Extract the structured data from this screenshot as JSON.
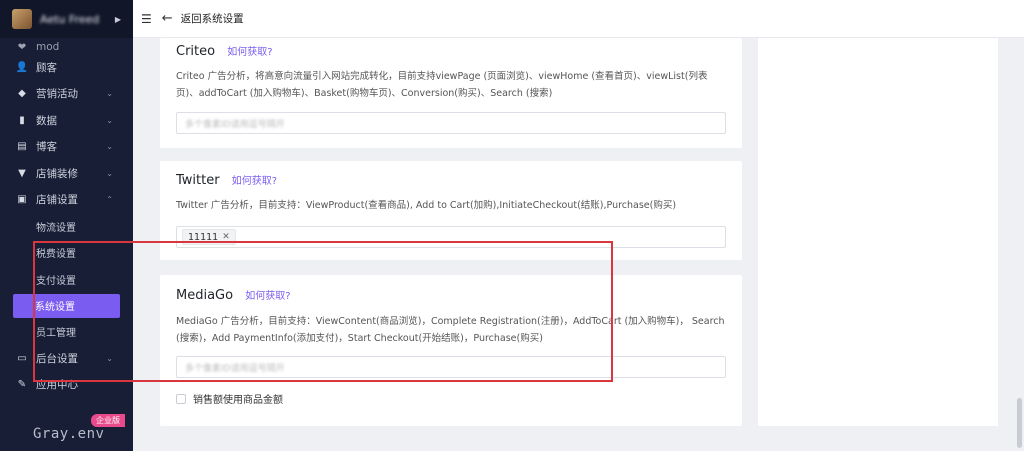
{
  "sidebar": {
    "store_name": "Aetu Freed",
    "items": [
      {
        "label": "mod",
        "icon": "heart-icon",
        "partial": true
      },
      {
        "label": "顾客",
        "icon": "user-icon",
        "chevron": false
      },
      {
        "label": "营销活动",
        "icon": "tag-icon",
        "chevron": true
      },
      {
        "label": "数据",
        "icon": "bar-chart-icon",
        "chevron": true
      },
      {
        "label": "博客",
        "icon": "document-icon",
        "chevron": true
      },
      {
        "label": "店铺装修",
        "icon": "paint-roller-icon",
        "chevron": true
      },
      {
        "label": "店铺设置",
        "icon": "store-settings-icon",
        "chevron": true,
        "expanded": true
      }
    ],
    "sub_items": [
      {
        "label": "物流设置"
      },
      {
        "label": "税费设置"
      },
      {
        "label": "支付设置"
      },
      {
        "label": "系统设置",
        "active": true
      },
      {
        "label": "员工管理"
      }
    ],
    "bottom_items": [
      {
        "label": "后台设置",
        "icon": "monitor-icon",
        "chevron": true
      },
      {
        "label": "应用中心",
        "icon": "wrench-icon",
        "chevron": false
      }
    ],
    "enterprise_badge": "企业版",
    "watermark": "Gray.env",
    "accent_color": "#7b5cf0"
  },
  "topbar": {
    "back_label": "返回系统设置"
  },
  "cards": {
    "criteo": {
      "title": "Criteo",
      "link": "如何获取?",
      "desc": "Criteo 广告分析，将高意向流量引入网站完成转化，目前支持viewPage (页面浏览)、viewHome (查看首页)、viewList(列表页)、addToCart (加入购物车)、Basket(购物车页)、Conversion(购买)、Search (搜索)",
      "placeholder": "多个像素ID请用逗号隔开"
    },
    "twitter": {
      "title": "Twitter",
      "link": "如何获取?",
      "desc": "Twitter 广告分析，目前支持：ViewProduct(查看商品), Add to Cart(加购),InitiateCheckout(结账),Purchase(购买)",
      "tag": "11111"
    },
    "mediago": {
      "title": "MediaGo",
      "link": "如何获取?",
      "desc": "MediaGo 广告分析，目前支持：ViewContent(商品浏览)，Complete Registration(注册)，AddToCart (加入购物车)， Search (搜索)，Add PaymentInfo(添加支付)，Start Checkout(开始结账)，Purchase(购买)",
      "placeholder": "多个像素ID请用逗号隔开",
      "checkbox_label": "销售额使用商品金额"
    }
  },
  "colors": {
    "highlight_border": "#d9363e",
    "link": "#7b5cf0"
  }
}
